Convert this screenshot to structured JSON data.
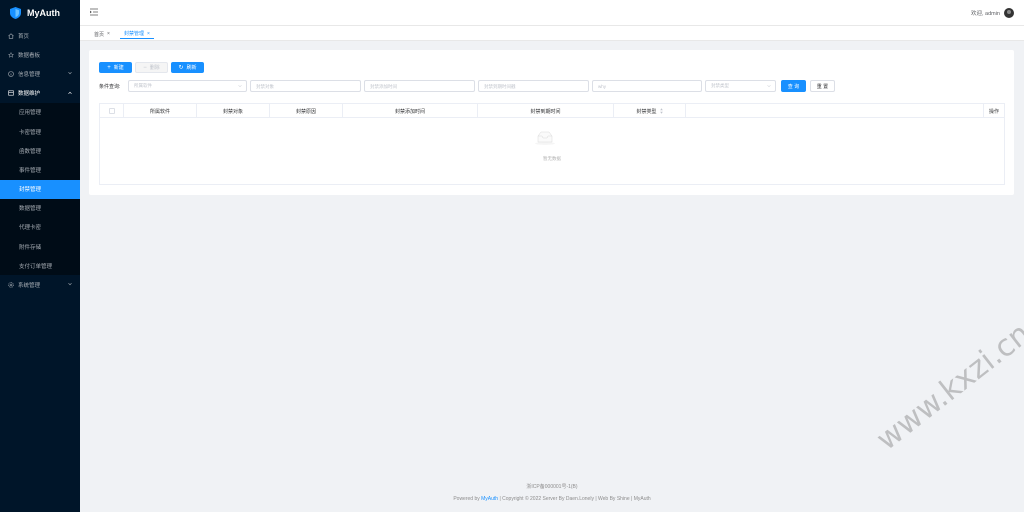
{
  "app": {
    "name": "MyAuth",
    "accent_color": "#1890ff",
    "sidebar_bg": "#001529"
  },
  "sidebar": {
    "items": [
      {
        "label": "首页",
        "icon": "home-icon"
      },
      {
        "label": "数据看板",
        "icon": "dashboard-icon"
      },
      {
        "label": "信息管理",
        "icon": "info-icon"
      },
      {
        "label": "数据维护",
        "icon": "database-icon"
      },
      {
        "label": "系统管理",
        "icon": "gear-icon"
      }
    ],
    "submenu": [
      {
        "label": "应用管理"
      },
      {
        "label": "卡密管理"
      },
      {
        "label": "函数管理"
      },
      {
        "label": "事件管理"
      },
      {
        "label": "封禁管理"
      },
      {
        "label": "数据管理"
      },
      {
        "label": "代理卡密"
      },
      {
        "label": "附件存储"
      },
      {
        "label": "支付订单管理"
      }
    ]
  },
  "header": {
    "welcome": "欢迎, admin"
  },
  "tabs": [
    {
      "label": "首页"
    },
    {
      "label": "封禁管理"
    }
  ],
  "toolbar": {
    "new_label": "新建",
    "delete_label": "删除",
    "refresh_label": "刷新"
  },
  "filters": {
    "label": "条件查询:",
    "software_placeholder": "所属软件",
    "target_placeholder": "封禁对象",
    "added_time_placeholder": "封禁添加时间",
    "expire_time_placeholder": "封禁到期时间戳",
    "reason_placeholder": "why",
    "type_placeholder": "封禁类型",
    "query_label": "查 询",
    "reset_label": "重 置"
  },
  "table": {
    "columns": [
      "所属软件",
      "封禁对象",
      "封禁原因",
      "封禁添加时间",
      "封禁到期时间",
      "封禁类型",
      "",
      "操作"
    ],
    "empty_text": "暂无数据"
  },
  "footer": {
    "icp": "浙ICP备000001号-1(B)",
    "powered_prefix": "Powered by ",
    "powered_link": "MyAuth",
    "powered_suffix": " | Copyright © 2022 Server By Daen.Lonely | Web By Shine | MyAuth"
  },
  "watermark": {
    "text": "www.kxzi.cn"
  }
}
